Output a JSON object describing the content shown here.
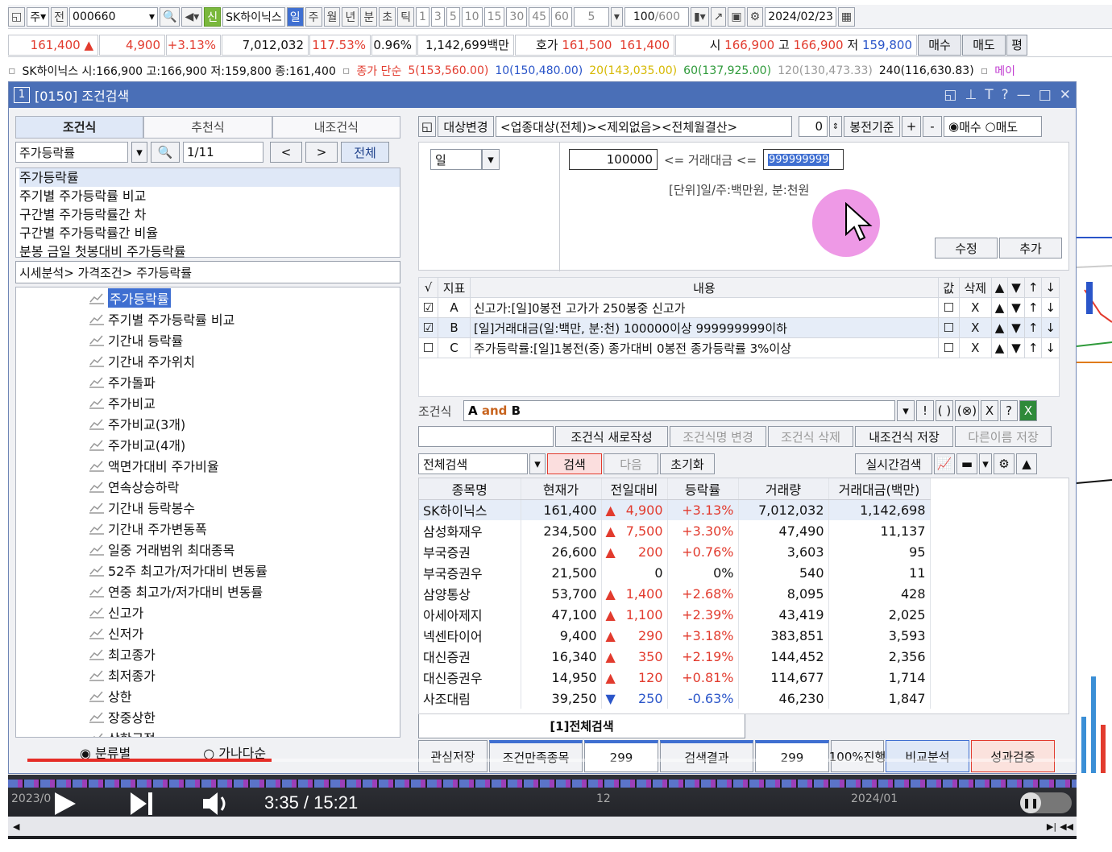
{
  "toolbar1": {
    "items": [
      "주",
      "전",
      "000660",
      "신",
      "SK하이닉스",
      "일",
      "주",
      "월",
      "년",
      "분",
      "초",
      "틱",
      "1",
      "3",
      "5",
      "10",
      "15",
      "30",
      "45",
      "60",
      "5",
      "100",
      "/600",
      "2024/02/23"
    ]
  },
  "quote": {
    "price": "161,400",
    "change": "4,900",
    "rate": "+3.13%",
    "volume": "7,012,032",
    "vol_ratio": "117.53%",
    "turnover": "0.96%",
    "amount": "1,142,699백만",
    "hoga_label": "호가",
    "ask": "161,500",
    "bid": "161,400",
    "open_label": "시",
    "open": "166,900",
    "high_label": "고",
    "high": "166,900",
    "low_label": "저",
    "low": "159,800",
    "buy": "매수",
    "sell": "매도",
    "eval": "평"
  },
  "ticker": {
    "summary": "SK하이닉스 시:166,900 고:166,900 저:159,800 종:161,400",
    "ma_title": "종가 단순",
    "ma5": "5(153,560.00)",
    "ma10": "10(150,480.00)",
    "ma20": "20(143,035.00)",
    "ma60": "60(137,925.00)",
    "ma120": "120(130,473.33)",
    "ma240": "240(116,630.83)",
    "more": "메이"
  },
  "window": {
    "num": "1",
    "title": "[0150] 조건검색"
  },
  "left": {
    "tabs": [
      "조건식",
      "추천식",
      "내조건식"
    ],
    "search_value": "주가등락률",
    "page": "1/11",
    "prev": "<",
    "next": ">",
    "all": "전체",
    "results": [
      "주가등락률",
      "주기별 주가등락률 비교",
      "구간별 주가등락률간 차",
      "구간별 주가등락률간 비율",
      "분봉 금일 첫봉대비 주가등락률"
    ],
    "path": "시세분석> 가격조건> 주가등락률",
    "tree": [
      "주가등락률",
      "주기별 주가등락률 비교",
      "기간내 등락률",
      "기간내 주가위치",
      "주가돌파",
      "주가비교",
      "주가비교(3개)",
      "주가비교(4개)",
      "액면가대비 주가비율",
      "연속상승하락",
      "기간내 등락봉수",
      "기간내 주가변동폭",
      "일중 거래범위 최대종목",
      "52주 최고가/저가대비 변동률",
      "연중 최고가/저가대비 변동률",
      "신고가",
      "신저가",
      "최고종가",
      "최저종가",
      "상한",
      "장중상한",
      "상한근접"
    ],
    "radio1": "분류별",
    "radio2": "가나다순"
  },
  "right": {
    "target_btn": "대상변경",
    "target_text": "<업종대상(전체)><제외없음><전체월결산>",
    "bong": "0",
    "bong_label": "봉전기준",
    "plus": "+",
    "minus": "-",
    "buy": "매수",
    "sell": "매도",
    "period": "일",
    "amount_min": "100000",
    "amount_label": "<= 거래대금 <=",
    "amount_max": "999999999",
    "unit_note": "[단위]일/주:백만원, 분:천원",
    "edit": "수정",
    "add": "추가",
    "grid_headers": [
      "√",
      "지표",
      "내용",
      "값",
      "삭제",
      "▲",
      "▼",
      "↑",
      "↓"
    ],
    "conditions": [
      {
        "checked": true,
        "key": "A",
        "content": "신고가:[일]0봉전 고가가 250봉중 신고가"
      },
      {
        "checked": true,
        "key": "B",
        "content": "[일]거래대금(일:백만, 분:천) 100000이상 999999999이하"
      },
      {
        "checked": false,
        "key": "C",
        "content": "주가등락률:[일]1봉전(중) 종가대비 0봉전 종가등락률 3%이상"
      }
    ],
    "formula_label": "조건식",
    "formula": "A and B",
    "btn_new": "조건식 새로작성",
    "btn_rename": "조건식명 변경",
    "btn_delete": "조건식 삭제",
    "btn_save": "내조건식 저장",
    "btn_saveas": "다른이름 저장",
    "scope": "전체검색",
    "search": "검색",
    "next": "다음",
    "reset": "초기화",
    "realtime": "실시간검색",
    "result_headers": [
      "종목명",
      "현재가",
      "전일대비",
      "등락률",
      "거래량",
      "거래대금(백만)"
    ],
    "results": [
      {
        "name": "SK하이닉스",
        "price": "161,400",
        "dir": "up",
        "diff": "4,900",
        "rate": "+3.13%",
        "vol": "7,012,032",
        "amt": "1,142,698"
      },
      {
        "name": "삼성화재우",
        "price": "234,500",
        "dir": "up",
        "diff": "7,500",
        "rate": "+3.30%",
        "vol": "47,490",
        "amt": "11,137"
      },
      {
        "name": "부국증권",
        "price": "26,600",
        "dir": "up",
        "diff": "200",
        "rate": "+0.76%",
        "vol": "3,603",
        "amt": "95"
      },
      {
        "name": "부국증권우",
        "price": "21,500",
        "dir": "",
        "diff": "0",
        "rate": "0%",
        "vol": "540",
        "amt": "11"
      },
      {
        "name": "삼양통상",
        "price": "53,700",
        "dir": "up",
        "diff": "1,400",
        "rate": "+2.68%",
        "vol": "8,095",
        "amt": "428"
      },
      {
        "name": "아세아제지",
        "price": "47,100",
        "dir": "up",
        "diff": "1,100",
        "rate": "+2.39%",
        "vol": "43,419",
        "amt": "2,025"
      },
      {
        "name": "넥센타이어",
        "price": "9,400",
        "dir": "up",
        "diff": "290",
        "rate": "+3.18%",
        "vol": "383,851",
        "amt": "3,593"
      },
      {
        "name": "대신증권",
        "price": "16,340",
        "dir": "up",
        "diff": "350",
        "rate": "+2.19%",
        "vol": "144,452",
        "amt": "2,356"
      },
      {
        "name": "대신증권우",
        "price": "14,950",
        "dir": "up",
        "diff": "120",
        "rate": "+0.81%",
        "vol": "114,677",
        "amt": "1,714"
      },
      {
        "name": "사조대림",
        "price": "39,250",
        "dir": "down",
        "diff": "250",
        "rate": "-0.63%",
        "vol": "46,230",
        "amt": "1,847"
      }
    ],
    "tab": "[1]전체검색",
    "watch_save": "관심저장",
    "cond_label": "조건만족종목",
    "cond_count": "299",
    "result_label": "검색결과",
    "result_count": "299",
    "progress": "100%진행",
    "compare": "비교분석",
    "verify": "성과검증"
  },
  "player": {
    "time": "3:35 / 15:21",
    "progress": 0.233,
    "date1": "2023/0",
    "date2": "12",
    "date3": "2024/01"
  },
  "colors": {
    "up": "#e23b2e",
    "down": "#2a55c9",
    "title_bar": "#4a6fb7",
    "progress": "#e52d27"
  }
}
